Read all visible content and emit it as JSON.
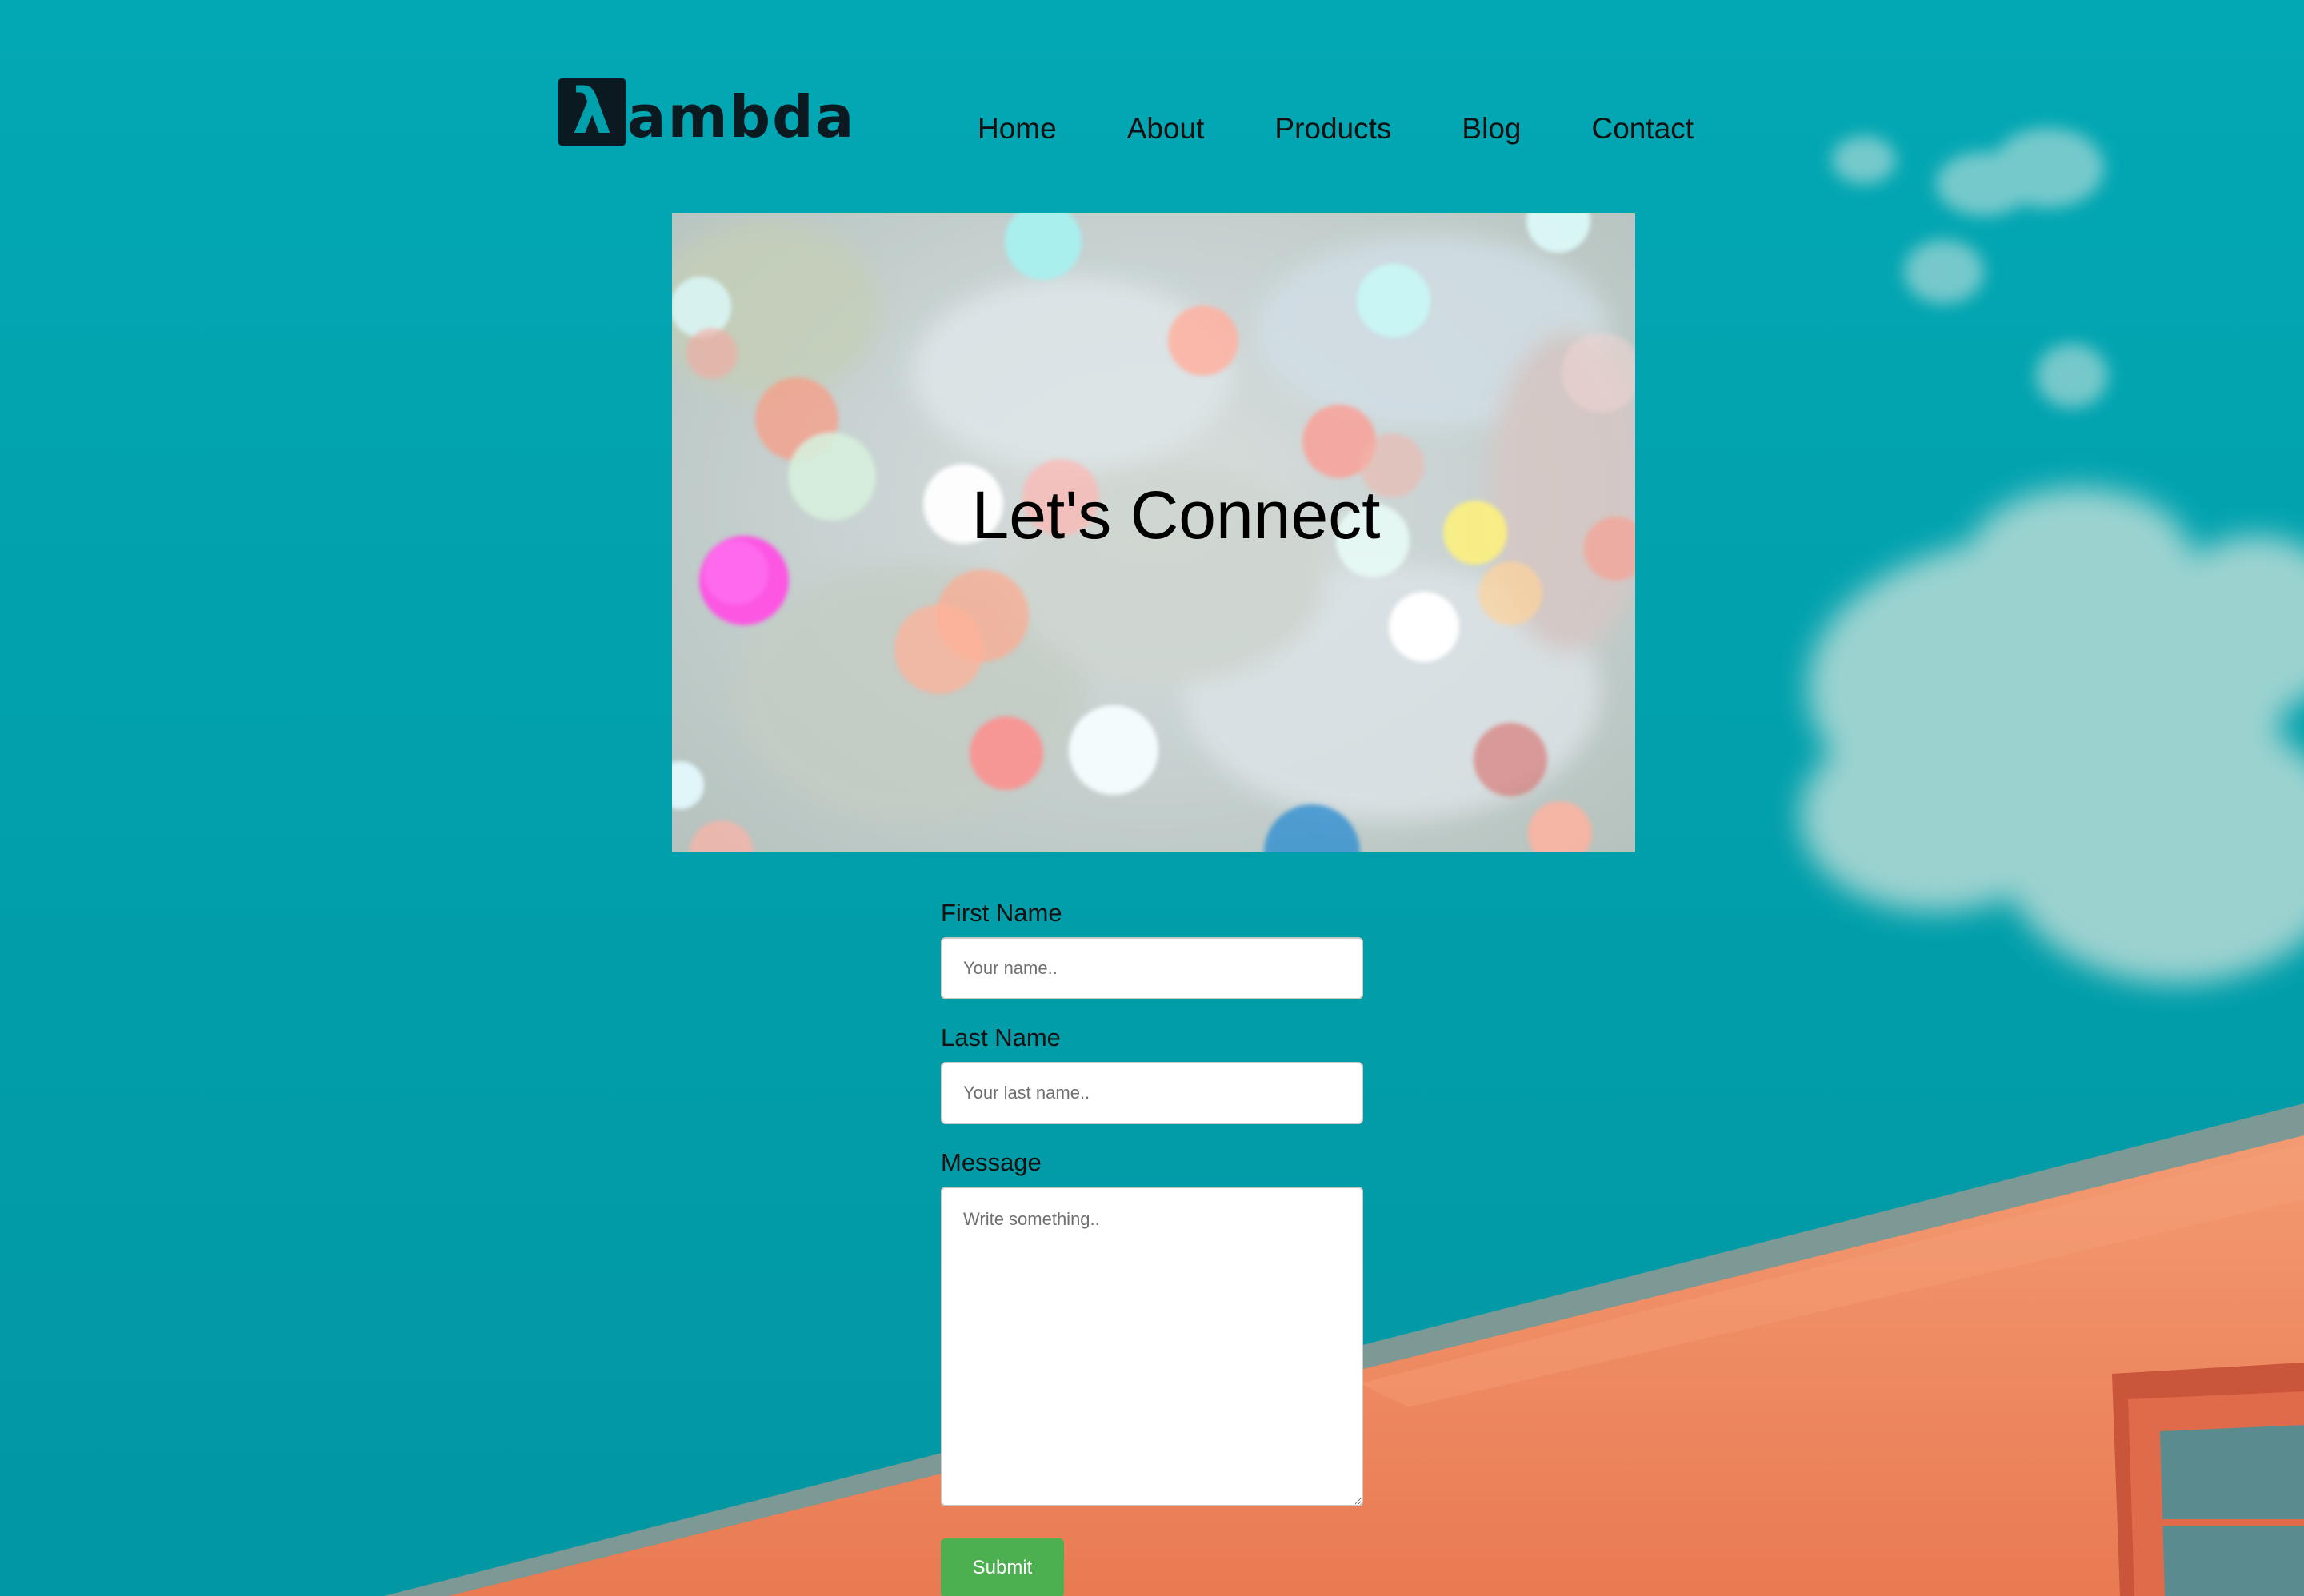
{
  "brand": {
    "logo_mark": "λ",
    "logo_text": "ambda"
  },
  "nav": {
    "items": [
      {
        "label": "Home"
      },
      {
        "label": "About"
      },
      {
        "label": "Products"
      },
      {
        "label": "Blog"
      },
      {
        "label": "Contact"
      }
    ]
  },
  "hero": {
    "title": "Let's Connect"
  },
  "form": {
    "first_name": {
      "label": "First Name",
      "placeholder": "Your name.."
    },
    "last_name": {
      "label": "Last Name",
      "placeholder": "Your last name.."
    },
    "message": {
      "label": "Message",
      "placeholder": "Write something.."
    },
    "submit_label": "Submit"
  },
  "colors": {
    "sky": "#00a0ad",
    "building": "#f08a64",
    "submit": "#4caf50"
  }
}
